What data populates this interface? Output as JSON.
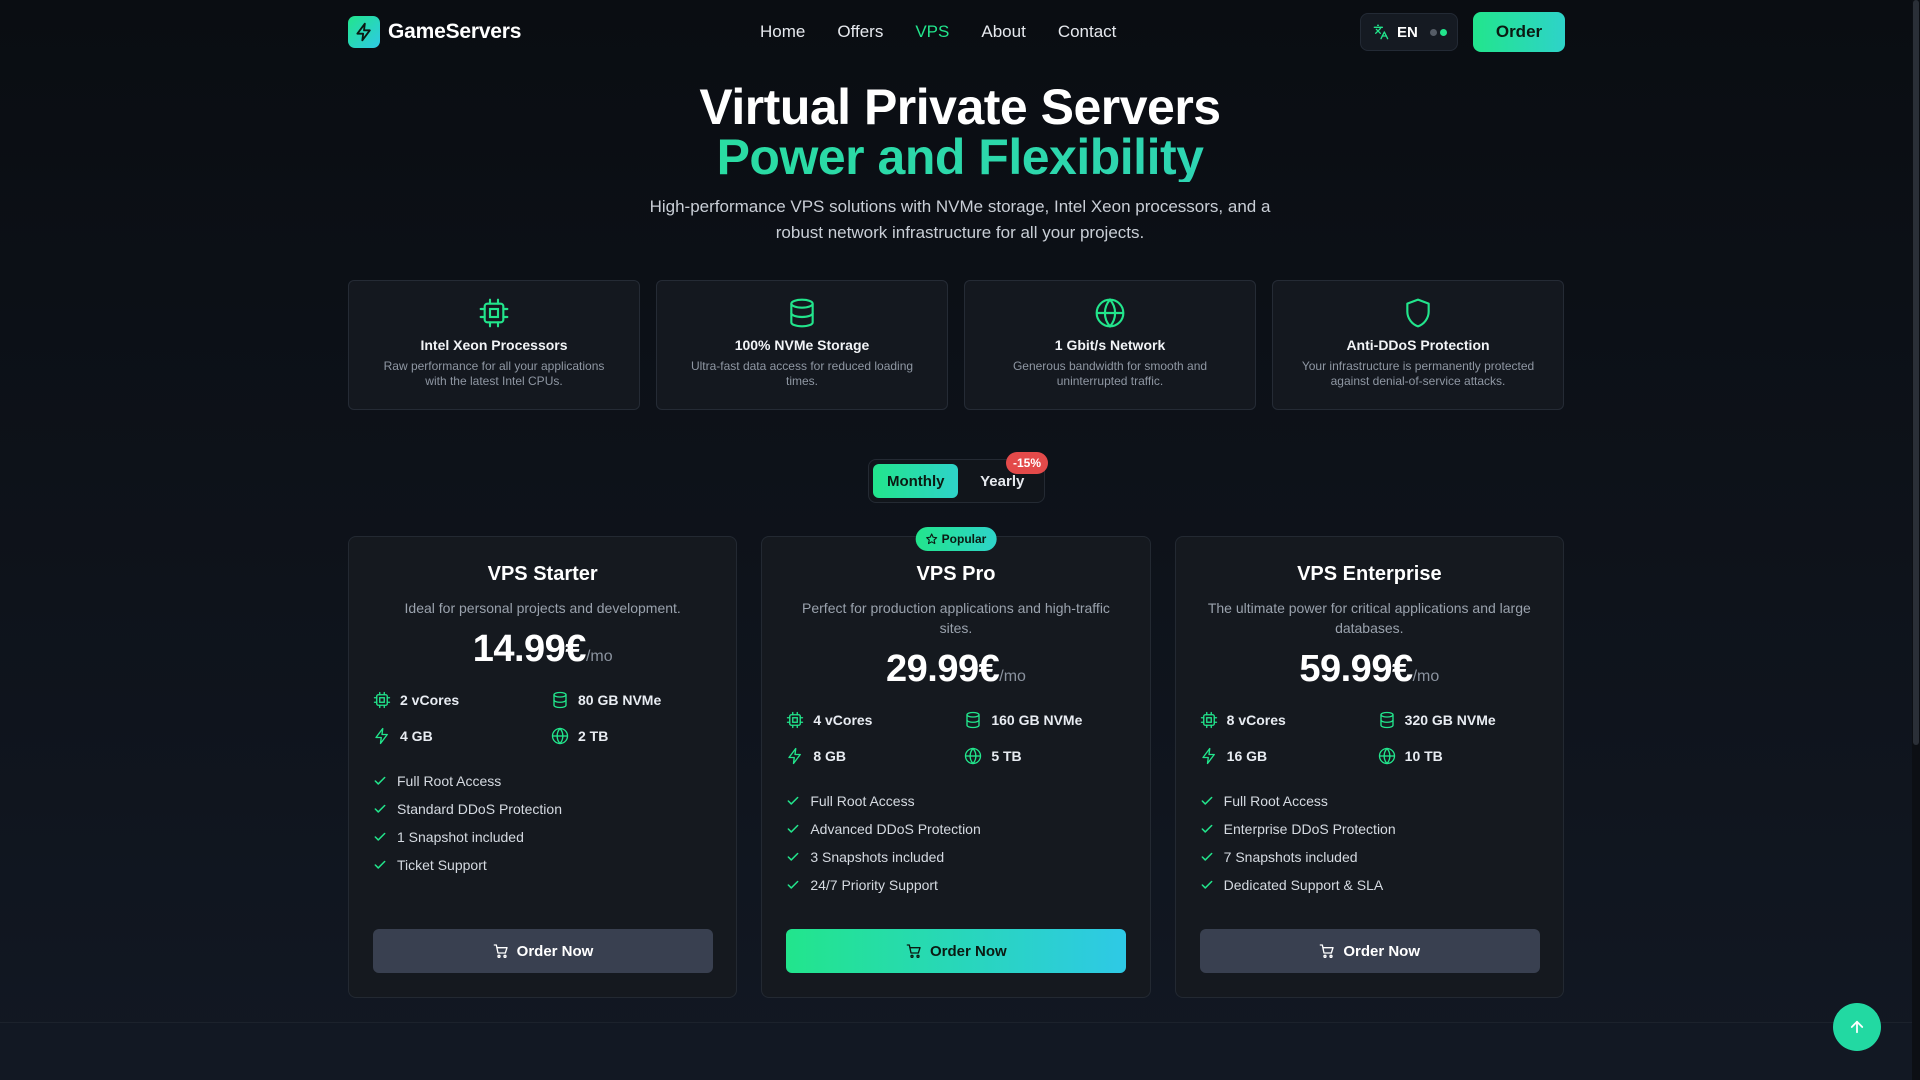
{
  "nav": {
    "brand": "GameServers",
    "links": [
      {
        "label": "Home",
        "active": false
      },
      {
        "label": "Offers",
        "active": false
      },
      {
        "label": "VPS",
        "active": true
      },
      {
        "label": "About",
        "active": false
      },
      {
        "label": "Contact",
        "active": false
      }
    ],
    "language": "EN",
    "order_label": "Order"
  },
  "hero": {
    "title": "Virtual Private Servers",
    "title_accent": "Power and Flexibility",
    "subtitle": "High-performance VPS solutions with NVMe storage, Intel Xeon processors, and a robust network infrastructure for all your projects."
  },
  "features": [
    {
      "icon": "cpu-icon",
      "title": "Intel Xeon Processors",
      "text": "Raw performance for all your applications with the latest Intel CPUs."
    },
    {
      "icon": "database-icon",
      "title": "100% NVMe Storage",
      "text": "Ultra-fast data access for reduced loading times."
    },
    {
      "icon": "globe-icon",
      "title": "1 Gbit/s Network",
      "text": "Generous bandwidth for smooth and uninterrupted traffic."
    },
    {
      "icon": "shield-icon",
      "title": "Anti-DDoS Protection",
      "text": "Your infrastructure is permanently protected against denial-of-service attacks."
    }
  ],
  "billing": {
    "monthly_label": "Monthly",
    "yearly_label": "Yearly",
    "discount": "-15%",
    "selected": "Monthly"
  },
  "plans": [
    {
      "name": "VPS Starter",
      "description": "Ideal for personal projects and development.",
      "price": "14.99€",
      "period": "/mo",
      "cores": "2 vCores",
      "storage": "80 GB NVMe",
      "ram": "4 GB",
      "bandwidth": "2 TB",
      "checks": [
        "Full Root Access",
        "Standard DDoS Protection",
        "1 Snapshot included",
        "Ticket Support"
      ],
      "button": "Order Now",
      "popular": false
    },
    {
      "name": "VPS Pro",
      "description": "Perfect for production applications and high-traffic sites.",
      "price": "29.99€",
      "period": "/mo",
      "cores": "4 vCores",
      "storage": "160 GB NVMe",
      "ram": "8 GB",
      "bandwidth": "5 TB",
      "checks": [
        "Full Root Access",
        "Advanced DDoS Protection",
        "3 Snapshots included",
        "24/7 Priority Support"
      ],
      "button": "Order Now",
      "popular": true,
      "badge": "Popular"
    },
    {
      "name": "VPS Enterprise",
      "description": "The ultimate power for critical applications and large databases.",
      "price": "59.99€",
      "period": "/mo",
      "cores": "8 vCores",
      "storage": "320 GB NVMe",
      "ram": "16 GB",
      "bandwidth": "10 TB",
      "checks": [
        "Full Root Access",
        "Enterprise DDoS Protection",
        "7 Snapshots included",
        "Dedicated Support & SLA"
      ],
      "button": "Order Now",
      "popular": false
    }
  ],
  "colors": {
    "accent_green": "#22e58c",
    "accent_cyan": "#2ec9e6",
    "background": "#0a0d12",
    "card": "#15191f",
    "badge_red": "#e34a4a"
  }
}
